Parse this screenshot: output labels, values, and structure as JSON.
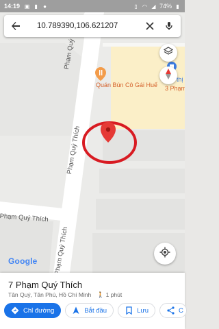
{
  "status_bar": {
    "time": "14:19",
    "battery": "74%",
    "icons": [
      "image-icon",
      "lock-icon",
      "chat-icon",
      "vibrate-icon",
      "wifi-icon",
      "signal-icon",
      "battery-icon"
    ]
  },
  "search": {
    "query": "10.789390,106.621207",
    "back_icon": "arrow-left-icon",
    "clear_icon": "close-icon",
    "voice_icon": "microphone-icon"
  },
  "map": {
    "street_labels": [
      "Phạm Quý Thích",
      "Phạm Quý Thích",
      "Phạm Quý Thích",
      "Phạm Quý Thích"
    ],
    "poi_label": "Quán Bún Cô Gái Huế",
    "partial_labels": [
      "thị",
      "3 Phạm"
    ],
    "logo": "Google",
    "pin_color": "#e53935",
    "circle_color": "#d81b22"
  },
  "place": {
    "title": "7 Phạm Quý Thích",
    "subtitle": "Tân Quý, Tân Phú, Hồ Chí Minh",
    "walk_time": "1 phút"
  },
  "actions": {
    "directions": "Chỉ đường",
    "start": "Bắt đầu",
    "save": "Lưu",
    "share": "C"
  },
  "colors": {
    "accent": "#1a73e8",
    "pin": "#e53935"
  }
}
